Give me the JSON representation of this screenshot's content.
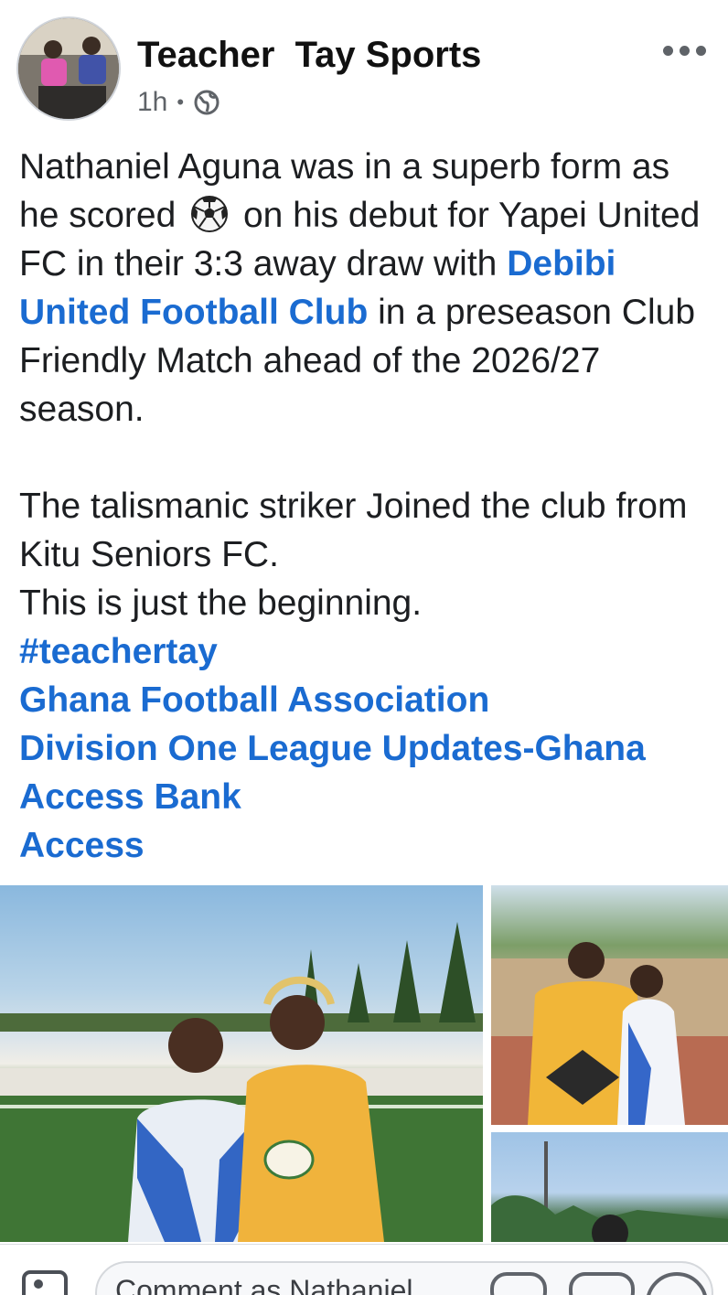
{
  "post": {
    "author": "Teacher  Tay Sports",
    "time": "1h",
    "separator": "•",
    "audience_icon": "globe-icon",
    "more_icon": "more-options-icon"
  },
  "body": {
    "intro_before_ball": "Nathaniel Aguna was in a superb form as he scored",
    "ball_icon": "soccer-ball-emoji",
    "intro_after_ball": "on his debut for Yapei United FC in their 3:3 away draw with",
    "club_link": "Debibi United Football Club",
    "intro_end": "in a preseason Club Friendly Match ahead of the 2026/27 season.",
    "line_2": "The talismanic striker Joined the club from Kitu Seniors FC.",
    "line_3": "This is just the beginning.",
    "hashtag": "#teachertay",
    "mentions": [
      "Ghana Football Association",
      "Division One League Updates-Ghana",
      "Access Bank",
      "Access"
    ]
  },
  "colors": {
    "link": "#1a6bd1",
    "text": "#1c1e21",
    "meta": "#5f6368"
  },
  "composer": {
    "placeholder": "Comment as Nathaniel",
    "camera_icon": "camera-icon",
    "icons": [
      "avatar-sticker-icon",
      "gif-icon",
      "emoji-icon"
    ]
  }
}
